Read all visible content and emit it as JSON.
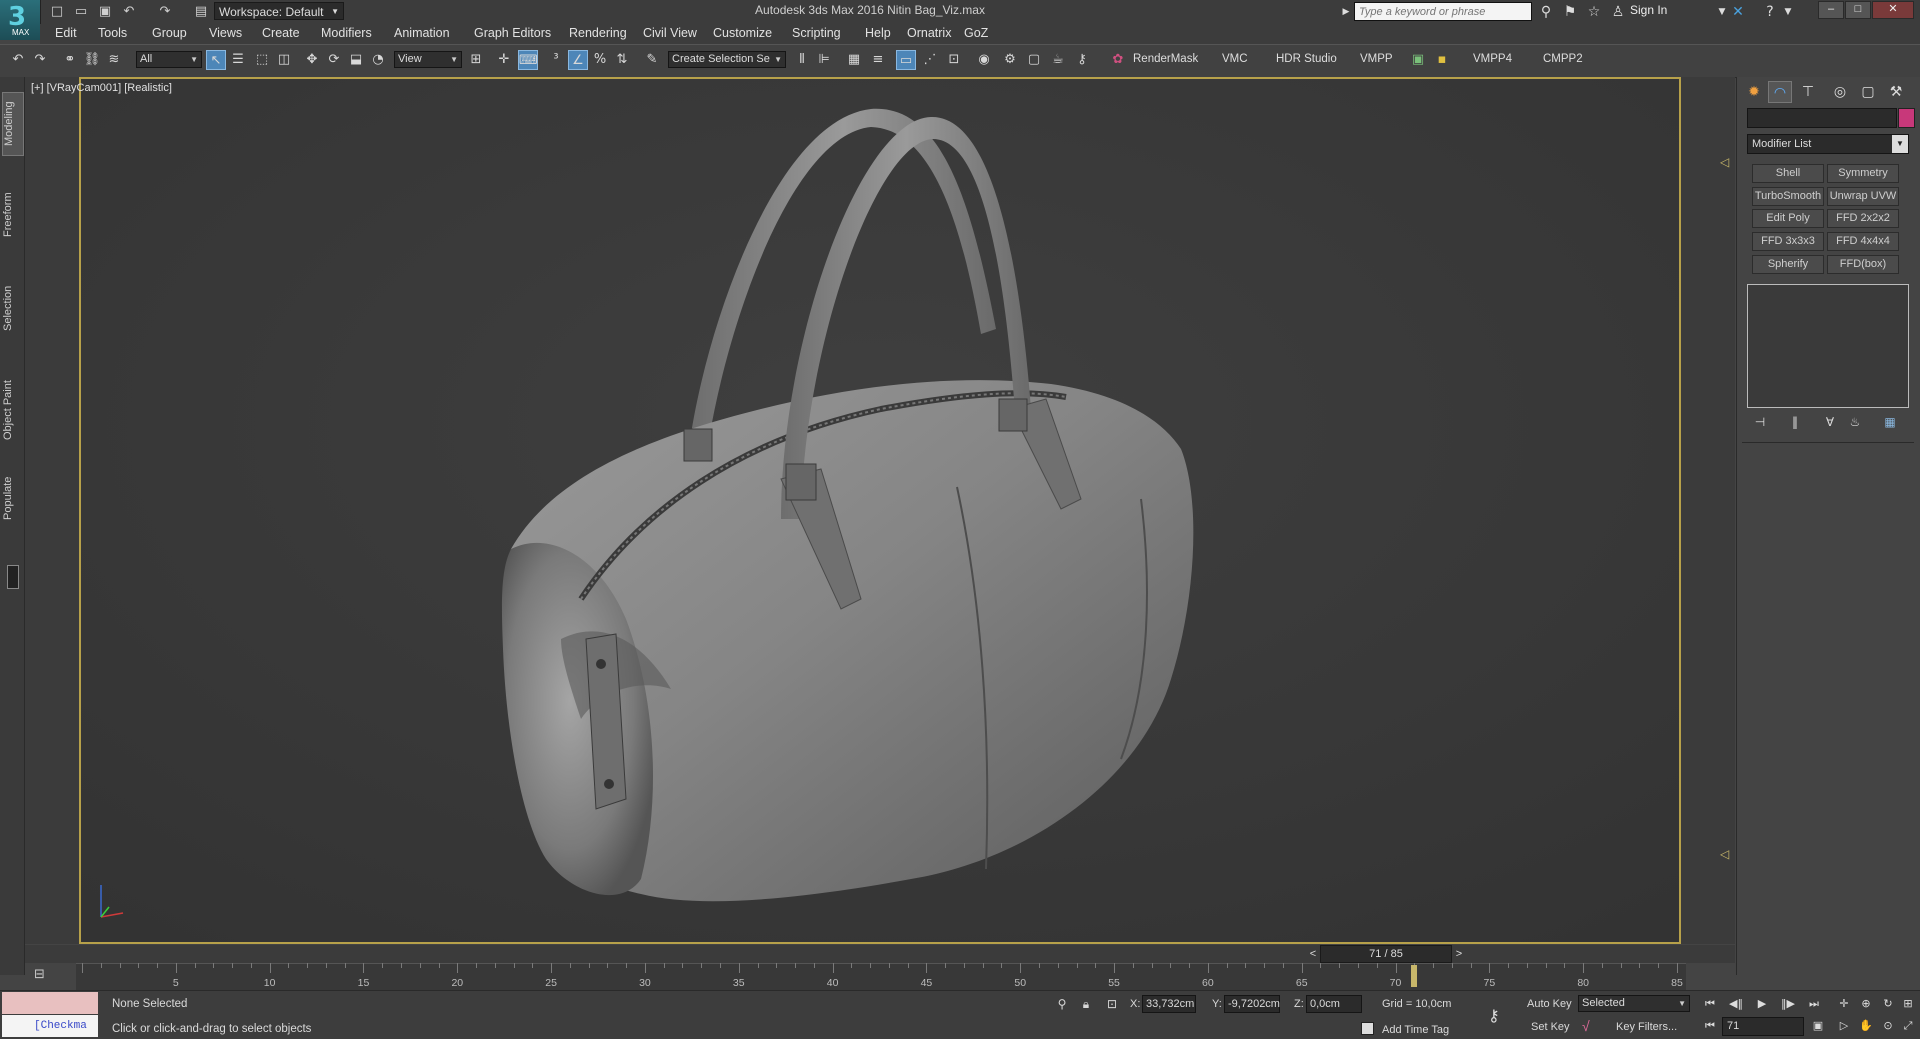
{
  "app": {
    "logo_text": "MAX",
    "title": "Autodesk 3ds Max 2016    Nitin Bag_Viz.max",
    "workspace": "Workspace: Default",
    "search_placeholder": "Type a keyword or phrase",
    "sign_in": "Sign In"
  },
  "menu": [
    "Edit",
    "Tools",
    "Group",
    "Views",
    "Create",
    "Modifiers",
    "Animation",
    "Graph Editors",
    "Rendering",
    "Civil View",
    "Customize",
    "Scripting",
    "Help",
    "Ornatrix",
    "GoZ"
  ],
  "toolbar": {
    "selection_filter": "All",
    "ref_coord": "View",
    "named_selection": "Create Selection Se",
    "plugins": [
      "RenderMask",
      "VMC",
      "HDR Studio",
      "VMPP",
      "VMPP4",
      "CMPP2"
    ]
  },
  "left_tabs": [
    "Modeling",
    "Freeform",
    "Selection",
    "Object Paint",
    "Populate"
  ],
  "viewport": {
    "label": "[+] [VRayCam001] [Realistic]",
    "bag_color": "#8a8a8a"
  },
  "command_panel": {
    "modifier_list": "Modifier List",
    "modifier_buttons": [
      "Shell",
      "Symmetry",
      "TurboSmooth",
      "Unwrap UVW",
      "Edit Poly",
      "FFD 2x2x2",
      "FFD 3x3x3",
      "FFD 4x4x4",
      "Spherify",
      "FFD(box)"
    ],
    "swatch_color": "#c8387a"
  },
  "timeline": {
    "frame_display": "71 / 85",
    "current_frame": 71,
    "total_frames": 85,
    "tick_labels": [
      "5",
      "10",
      "15",
      "20",
      "25",
      "30",
      "35",
      "40",
      "45",
      "50",
      "55",
      "60",
      "65",
      "70",
      "75",
      "80",
      "85"
    ]
  },
  "status": {
    "maxscript": "[Checkma",
    "selection": "None Selected",
    "prompt": "Click or click-and-drag to select objects",
    "x_label": "X:",
    "x_value": "33,732cm",
    "y_label": "Y:",
    "y_value": "-9,7202cm",
    "z_label": "Z:",
    "z_value": "0,0cm",
    "grid": "Grid = 10,0cm",
    "add_time_tag": "Add Time Tag",
    "auto_key": "Auto Key",
    "auto_key_mode": "Selected",
    "set_key": "Set Key",
    "key_filters": "Key Filters...",
    "frame_field": "71"
  }
}
